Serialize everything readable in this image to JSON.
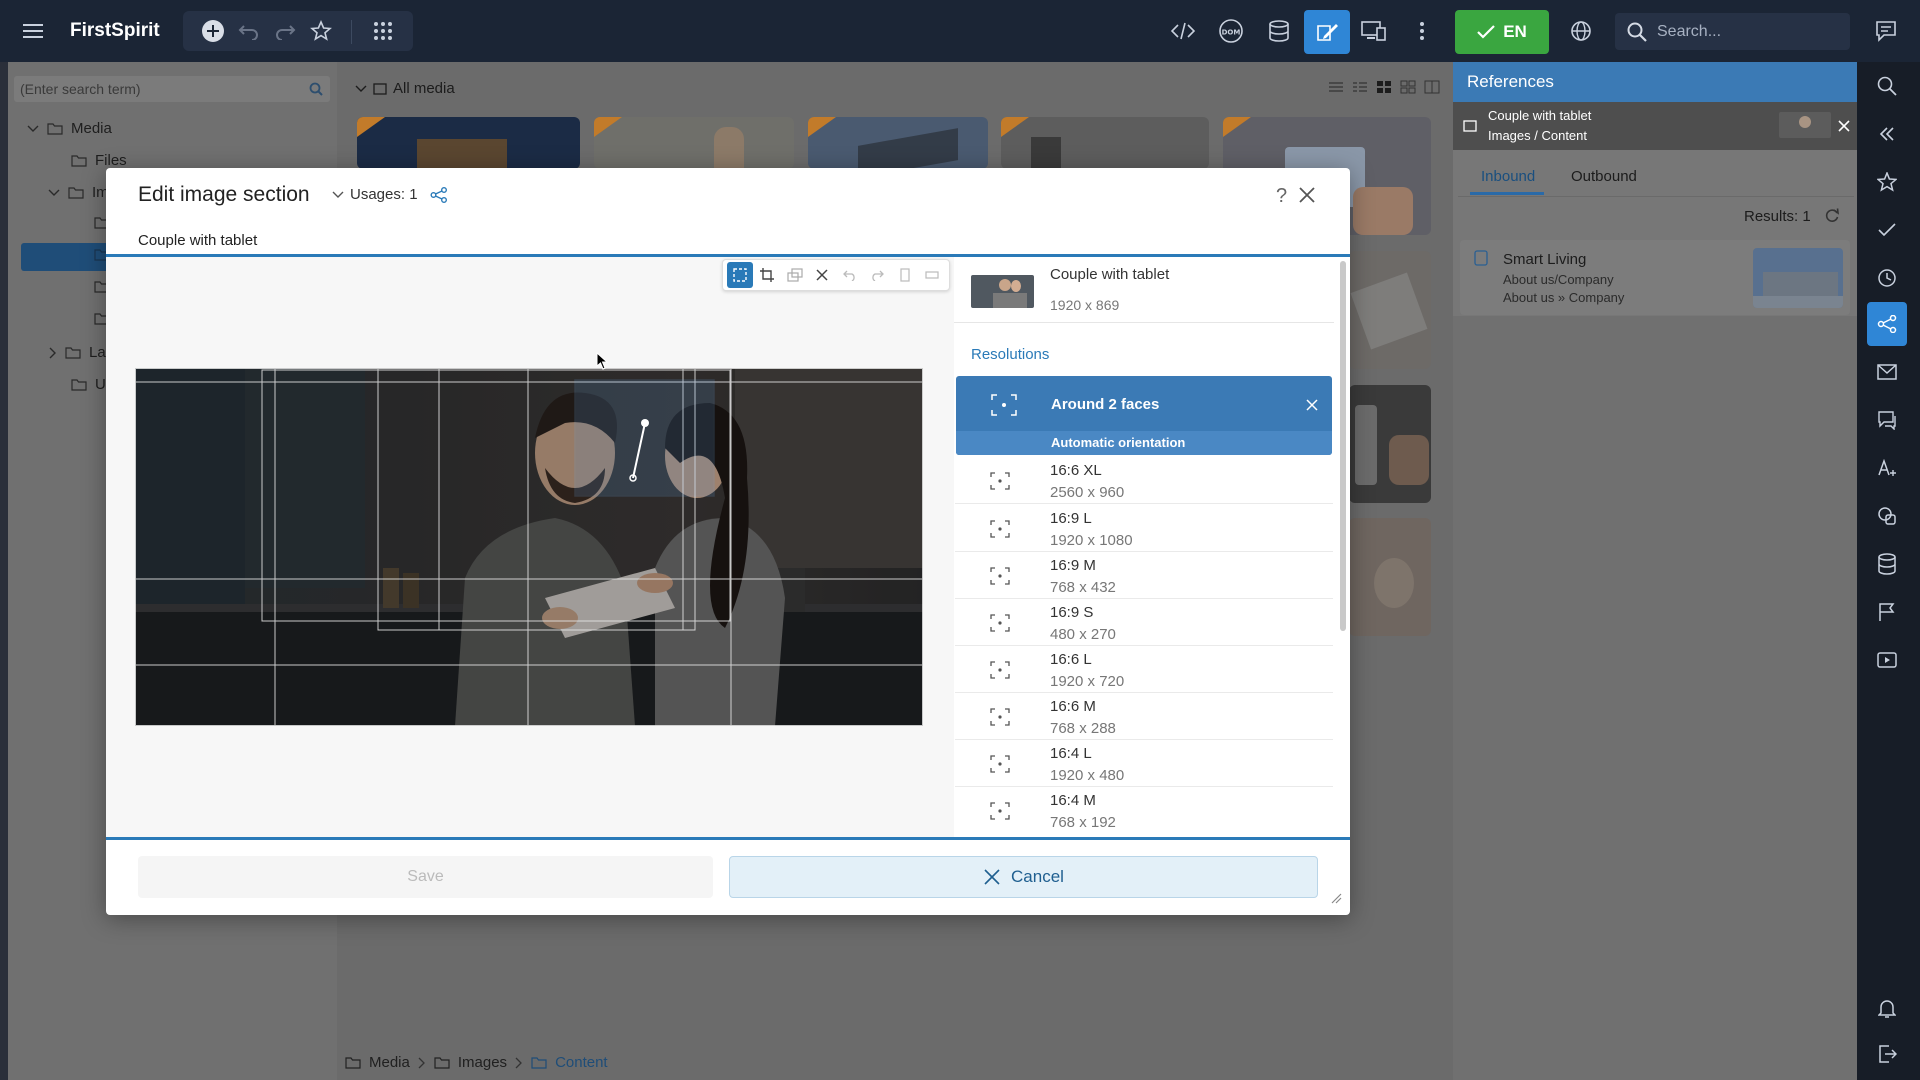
{
  "app": {
    "brand": "FirstSpirit",
    "language_label": "EN",
    "search_placeholder": "Search..."
  },
  "tree": {
    "search_placeholder": "(Enter search term)",
    "items": [
      {
        "label": "Media"
      },
      {
        "label": "Files"
      },
      {
        "label": "Im"
      },
      {
        "label": "La"
      },
      {
        "label": "U"
      }
    ]
  },
  "media": {
    "header": "All media",
    "breadcrumb": [
      "Media",
      "Images",
      "Content"
    ]
  },
  "references": {
    "title": "References",
    "item_title": "Couple with tablet",
    "item_path": "Images / Content",
    "tabs": [
      "Inbound",
      "Outbound"
    ],
    "results": "Results: 1",
    "card": {
      "title": "Smart Living",
      "line1": "About us/Company",
      "line2": "About us » Company"
    }
  },
  "modal": {
    "title": "Edit image section",
    "usages": "Usages: 1",
    "subtitle": "Couple with tablet",
    "image_title": "Couple with tablet",
    "image_size": "1920 x 869",
    "resolutions_heading": "Resolutions",
    "selected": {
      "name": "Around 2 faces",
      "note": "Automatic orientation"
    },
    "resolutions": [
      {
        "name": "16:6 XL",
        "size": "2560 x 960"
      },
      {
        "name": "16:9 L",
        "size": "1920 x 1080"
      },
      {
        "name": "16:9 M",
        "size": "768 x 432"
      },
      {
        "name": "16:9 S",
        "size": "480 x 270"
      },
      {
        "name": "16:6 L",
        "size": "1920 x 720"
      },
      {
        "name": "16:6 M",
        "size": "768 x 288"
      },
      {
        "name": "16:4 L",
        "size": "1920 x 480"
      },
      {
        "name": "16:4 M",
        "size": "768 x 192"
      }
    ],
    "save_label": "Save",
    "cancel_label": "Cancel",
    "help_label": "?"
  },
  "colors": {
    "accent": "#2a7ab8",
    "topbar": "#1b2535",
    "success": "#3aa640",
    "selected_row": "#3b7ab5"
  }
}
